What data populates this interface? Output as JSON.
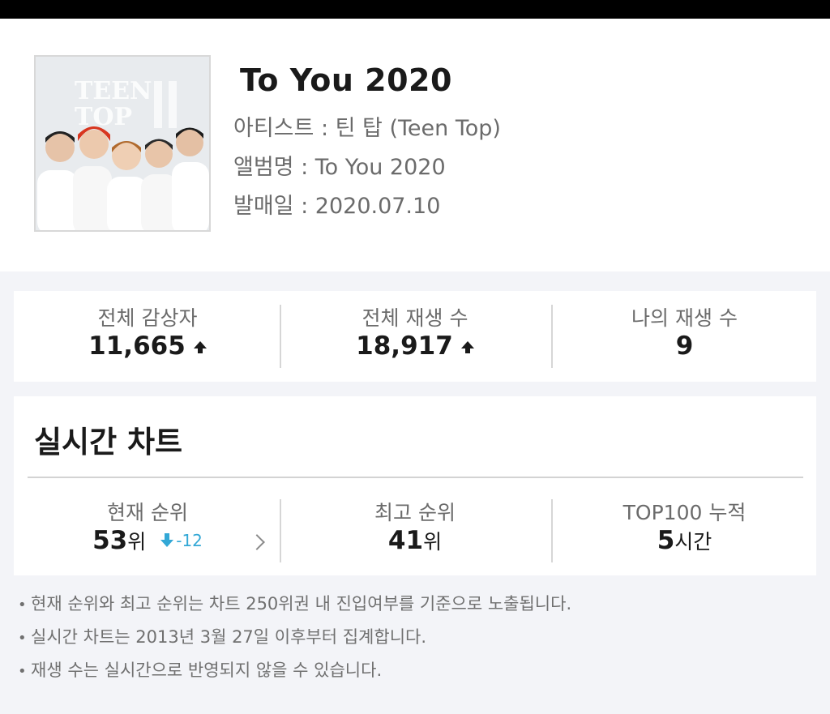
{
  "album": {
    "title": "To You 2020",
    "artist_line": "아티스트 : 틴 탑 (Teen Top)",
    "album_line": "앨범명 : To You 2020",
    "release_line": "발매일 : 2020.07.10",
    "cover_text_line1": "TEEN",
    "cover_text_line2": "TOP"
  },
  "stats": [
    {
      "label": "전체 감상자",
      "value": "11,665",
      "trend": "up"
    },
    {
      "label": "전체 재생 수",
      "value": "18,917",
      "trend": "up"
    },
    {
      "label": "나의 재생 수",
      "value": "9"
    }
  ],
  "realtime_chart": {
    "title": "실시간 차트",
    "current_rank": {
      "label": "현재 순위",
      "value": "53",
      "unit": "위",
      "change": "-12"
    },
    "best_rank": {
      "label": "최고 순위",
      "value": "41",
      "unit": "위"
    },
    "top100": {
      "label": "TOP100 누적",
      "value": "5",
      "unit": "시간"
    }
  },
  "notes": [
    "현재 순위와 최고 순위는 차트 250위권 내 진입여부를 기준으로 노출됩니다.",
    "실시간 차트는 2013년 3월 27일 이후부터 집계합니다.",
    "재생 수는 실시간으로 반영되지 않을 수 있습니다."
  ],
  "colors": {
    "accent_change": "#33a8d6",
    "page_bg": "#f3f4f8"
  }
}
